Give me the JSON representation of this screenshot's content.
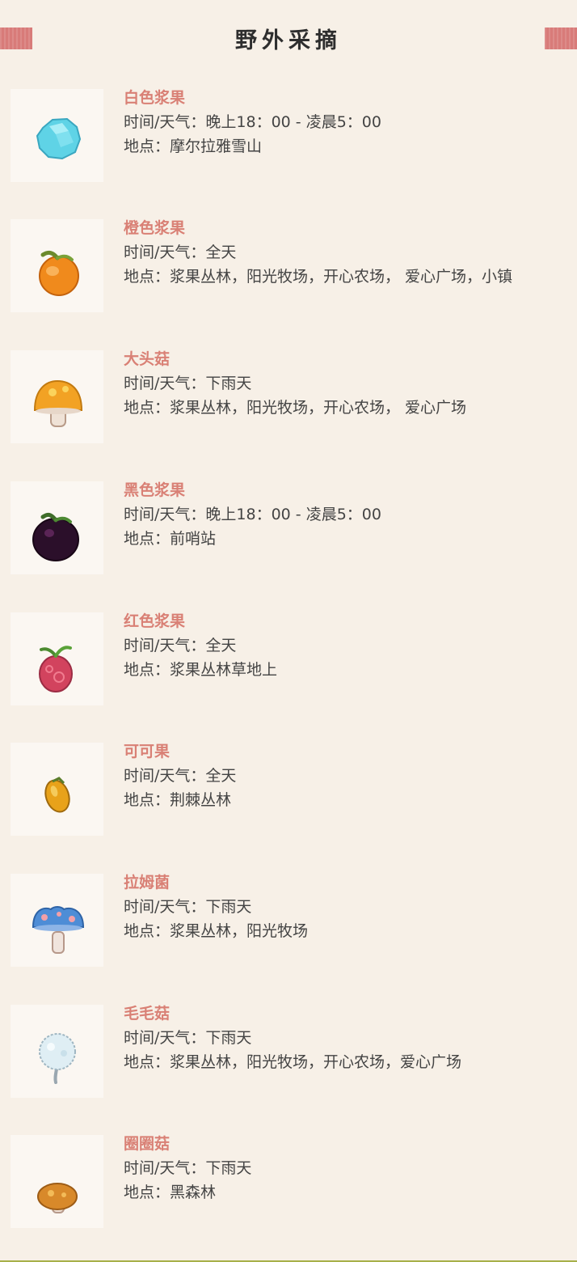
{
  "header": {
    "title": "野外采摘",
    "accent_color": "#d87b79"
  },
  "labels": {
    "time_prefix": "时间/天气：",
    "loc_prefix": "地点："
  },
  "items": [
    {
      "name": "白色浆果",
      "time": "晚上18：00 - 凌晨5：00",
      "location": "摩尔拉雅雪山",
      "icon": "blue-crystal-berry-icon"
    },
    {
      "name": "橙色浆果",
      "time": "全天",
      "location": "浆果丛林，阳光牧场，开心农场，  爱心广场，小镇",
      "icon": "orange-berry-icon"
    },
    {
      "name": "大头菇",
      "time": "下雨天",
      "location": "浆果丛林，阳光牧场，开心农场， 爱心广场",
      "icon": "big-mushroom-icon"
    },
    {
      "name": "黑色浆果",
      "time": "晚上18：00 - 凌晨5：00",
      "location": "前哨站",
      "icon": "black-berry-icon"
    },
    {
      "name": "红色浆果",
      "time": "全天",
      "location": "浆果丛林草地上",
      "icon": "red-berry-icon"
    },
    {
      "name": "可可果",
      "time": "全天",
      "location": "荆棘丛林",
      "icon": "cocoa-fruit-icon"
    },
    {
      "name": "拉姆菌",
      "time": "下雨天",
      "location": "浆果丛林，阳光牧场",
      "icon": "blue-mushroom-icon"
    },
    {
      "name": "毛毛菇",
      "time": "下雨天",
      "location": "浆果丛林，阳光牧场，开心农场，爱心广场",
      "icon": "fluffy-mushroom-icon"
    },
    {
      "name": "圈圈菇",
      "time": "下雨天",
      "location": "黑森林",
      "icon": "ring-mushroom-icon"
    }
  ]
}
